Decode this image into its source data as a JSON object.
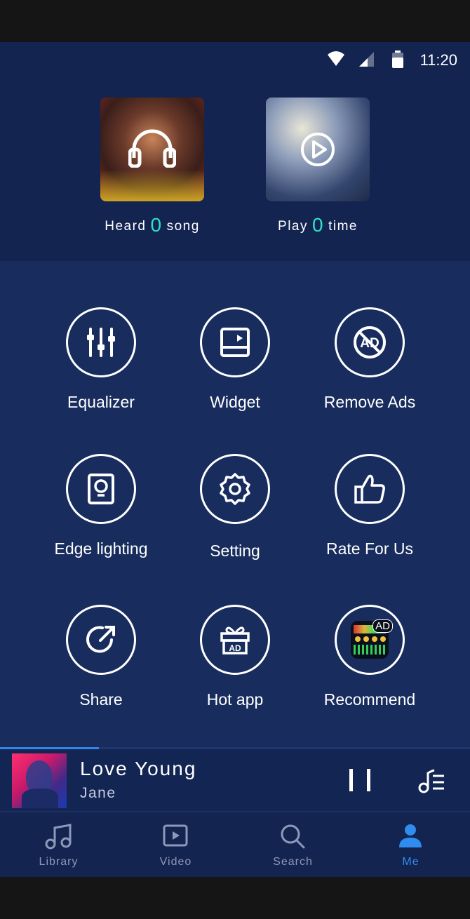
{
  "status_bar": {
    "time": "11:20",
    "icons": [
      "wifi-icon",
      "signal-icon",
      "battery-icon"
    ]
  },
  "stats": [
    {
      "prefix": "Heard",
      "count": "0",
      "suffix": "song",
      "icon": "headphones-icon"
    },
    {
      "prefix": "Play",
      "count": "0",
      "suffix": "time",
      "icon": "play-circle-icon"
    }
  ],
  "menu": [
    {
      "label": "Equalizer",
      "icon": "equalizer-icon"
    },
    {
      "label": "Widget",
      "icon": "widget-icon"
    },
    {
      "label": "Remove Ads",
      "icon": "no-ads-icon"
    },
    {
      "label": "Edge lighting",
      "icon": "lightbulb-icon"
    },
    {
      "label": "Setting",
      "icon": "gear-icon"
    },
    {
      "label": "Rate For Us",
      "icon": "thumbs-up-icon"
    },
    {
      "label": "Share",
      "icon": "share-icon"
    },
    {
      "label": "Hot app",
      "icon": "gift-ad-icon"
    },
    {
      "label": "Recommend",
      "icon": "recommend-app-icon",
      "badge": "AD"
    }
  ],
  "hot_app_icon_text": "AD",
  "player": {
    "title": "Love Young",
    "artist": "Jane",
    "progress": 0.21
  },
  "tabs": [
    {
      "label": "Library",
      "icon": "music-note-icon",
      "active": false
    },
    {
      "label": "Video",
      "icon": "video-icon",
      "active": false
    },
    {
      "label": "Search",
      "icon": "search-icon",
      "active": false
    },
    {
      "label": "Me",
      "icon": "person-icon",
      "active": true
    }
  ],
  "colors": {
    "background": "#182c5e",
    "header": "#142450",
    "accent_count": "#2de3c6",
    "active_tab": "#2f8df0",
    "inactive_tab": "#8d99b8"
  }
}
